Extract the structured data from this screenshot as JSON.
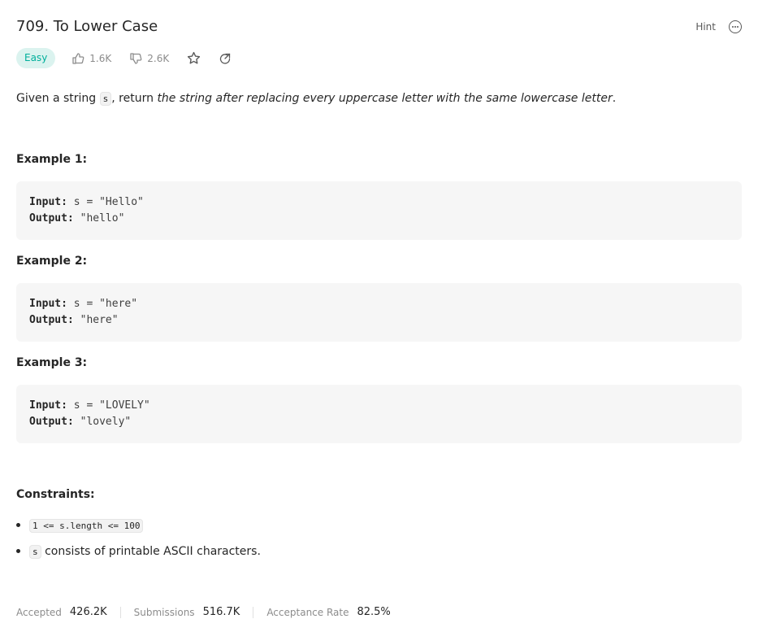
{
  "header": {
    "title": "709. To Lower Case",
    "hint_label": "Hint",
    "more_icon": "more-horizontal-icon"
  },
  "meta": {
    "difficulty": "Easy",
    "likes": "1.6K",
    "dislikes": "2.6K",
    "difficulty_color": "#00af9b",
    "difficulty_bg": "#dbf3ef"
  },
  "description": {
    "prefix": "Given a string ",
    "var": "s",
    "middle": ", return ",
    "emphasis": "the string after replacing every uppercase letter with the same lowercase letter",
    "suffix": "."
  },
  "examples": [
    {
      "heading": "Example 1:",
      "input_label": "Input:",
      "input": " s = \"Hello\"",
      "output_label": "Output:",
      "output": " \"hello\""
    },
    {
      "heading": "Example 2:",
      "input_label": "Input:",
      "input": " s = \"here\"",
      "output_label": "Output:",
      "output": " \"here\""
    },
    {
      "heading": "Example 3:",
      "input_label": "Input:",
      "input": " s = \"LOVELY\"",
      "output_label": "Output:",
      "output": " \"lovely\""
    }
  ],
  "constraints": {
    "heading": "Constraints:",
    "items": [
      {
        "code": "1 <= s.length <= 100",
        "text": ""
      },
      {
        "code": "s",
        "text": " consists of printable ASCII characters."
      }
    ]
  },
  "stats": {
    "accepted_label": "Accepted",
    "accepted_value": "426.2K",
    "submissions_label": "Submissions",
    "submissions_value": "516.7K",
    "rate_label": "Acceptance Rate",
    "rate_value": "82.5%"
  }
}
